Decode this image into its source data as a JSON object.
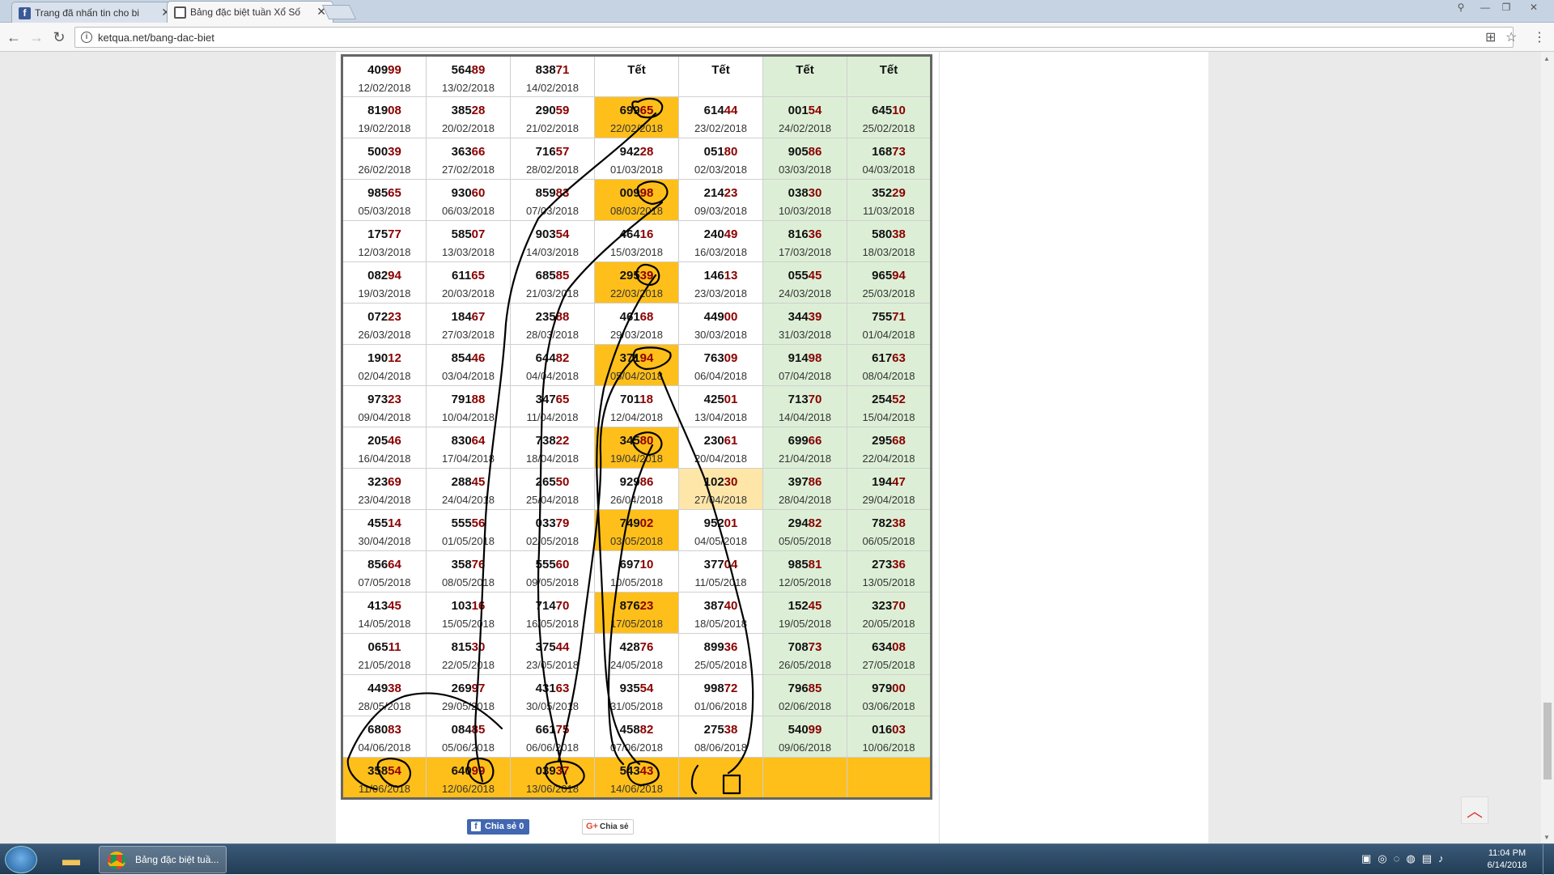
{
  "browser": {
    "tabs": [
      {
        "title": "Trang đã nhấn tin cho bi",
        "icon": "facebook-icon"
      },
      {
        "title": "Bảng đặc biệt tuần Xổ Số",
        "icon": "ketqua-icon"
      }
    ],
    "url": "ketqua.net/bang-dac-biet"
  },
  "table": {
    "rows": [
      [
        {
          "h": "409",
          "t": "99",
          "d": "12/02/2018",
          "c": "w"
        },
        {
          "h": "564",
          "t": "89",
          "d": "13/02/2018",
          "c": "w"
        },
        {
          "h": "838",
          "t": "71",
          "d": "14/02/2018",
          "c": "w"
        },
        {
          "h": "Tết",
          "t": "",
          "d": "",
          "c": "w"
        },
        {
          "h": "Tết",
          "t": "",
          "d": "",
          "c": "w"
        },
        {
          "h": "Tết",
          "t": "",
          "d": "",
          "c": "g"
        },
        {
          "h": "Tết",
          "t": "",
          "d": "",
          "c": "g"
        }
      ],
      [
        {
          "h": "819",
          "t": "08",
          "d": "19/02/2018",
          "c": "w"
        },
        {
          "h": "385",
          "t": "28",
          "d": "20/02/2018",
          "c": "w"
        },
        {
          "h": "290",
          "t": "59",
          "d": "21/02/2018",
          "c": "w"
        },
        {
          "h": "699",
          "t": "65",
          "d": "22/02/2018",
          "c": "o"
        },
        {
          "h": "614",
          "t": "44",
          "d": "23/02/2018",
          "c": "w"
        },
        {
          "h": "001",
          "t": "54",
          "d": "24/02/2018",
          "c": "g"
        },
        {
          "h": "645",
          "t": "10",
          "d": "25/02/2018",
          "c": "g"
        }
      ],
      [
        {
          "h": "500",
          "t": "39",
          "d": "26/02/2018",
          "c": "w"
        },
        {
          "h": "363",
          "t": "66",
          "d": "27/02/2018",
          "c": "w"
        },
        {
          "h": "716",
          "t": "57",
          "d": "28/02/2018",
          "c": "w"
        },
        {
          "h": "942",
          "t": "28",
          "d": "01/03/2018",
          "c": "w"
        },
        {
          "h": "051",
          "t": "80",
          "d": "02/03/2018",
          "c": "w"
        },
        {
          "h": "905",
          "t": "86",
          "d": "03/03/2018",
          "c": "g"
        },
        {
          "h": "168",
          "t": "73",
          "d": "04/03/2018",
          "c": "g"
        }
      ],
      [
        {
          "h": "985",
          "t": "65",
          "d": "05/03/2018",
          "c": "w"
        },
        {
          "h": "930",
          "t": "60",
          "d": "06/03/2018",
          "c": "w"
        },
        {
          "h": "859",
          "t": "83",
          "d": "07/03/2018",
          "c": "w"
        },
        {
          "h": "009",
          "t": "98",
          "d": "08/03/2018",
          "c": "o"
        },
        {
          "h": "214",
          "t": "23",
          "d": "09/03/2018",
          "c": "w"
        },
        {
          "h": "038",
          "t": "30",
          "d": "10/03/2018",
          "c": "g"
        },
        {
          "h": "352",
          "t": "29",
          "d": "11/03/2018",
          "c": "g"
        }
      ],
      [
        {
          "h": "175",
          "t": "77",
          "d": "12/03/2018",
          "c": "w"
        },
        {
          "h": "585",
          "t": "07",
          "d": "13/03/2018",
          "c": "w"
        },
        {
          "h": "903",
          "t": "54",
          "d": "14/03/2018",
          "c": "w"
        },
        {
          "h": "464",
          "t": "16",
          "d": "15/03/2018",
          "c": "w"
        },
        {
          "h": "240",
          "t": "49",
          "d": "16/03/2018",
          "c": "w"
        },
        {
          "h": "816",
          "t": "36",
          "d": "17/03/2018",
          "c": "g"
        },
        {
          "h": "580",
          "t": "38",
          "d": "18/03/2018",
          "c": "g"
        }
      ],
      [
        {
          "h": "082",
          "t": "94",
          "d": "19/03/2018",
          "c": "w"
        },
        {
          "h": "611",
          "t": "65",
          "d": "20/03/2018",
          "c": "w"
        },
        {
          "h": "685",
          "t": "85",
          "d": "21/03/2018",
          "c": "w"
        },
        {
          "h": "295",
          "t": "39",
          "d": "22/03/2018",
          "c": "o"
        },
        {
          "h": "146",
          "t": "13",
          "d": "23/03/2018",
          "c": "w"
        },
        {
          "h": "055",
          "t": "45",
          "d": "24/03/2018",
          "c": "g"
        },
        {
          "h": "965",
          "t": "94",
          "d": "25/03/2018",
          "c": "g"
        }
      ],
      [
        {
          "h": "072",
          "t": "23",
          "d": "26/03/2018",
          "c": "w"
        },
        {
          "h": "184",
          "t": "67",
          "d": "27/03/2018",
          "c": "w"
        },
        {
          "h": "235",
          "t": "88",
          "d": "28/03/2018",
          "c": "w"
        },
        {
          "h": "461",
          "t": "68",
          "d": "29/03/2018",
          "c": "w"
        },
        {
          "h": "449",
          "t": "00",
          "d": "30/03/2018",
          "c": "w"
        },
        {
          "h": "344",
          "t": "39",
          "d": "31/03/2018",
          "c": "g"
        },
        {
          "h": "755",
          "t": "71",
          "d": "01/04/2018",
          "c": "g"
        }
      ],
      [
        {
          "h": "190",
          "t": "12",
          "d": "02/04/2018",
          "c": "w"
        },
        {
          "h": "854",
          "t": "46",
          "d": "03/04/2018",
          "c": "w"
        },
        {
          "h": "644",
          "t": "82",
          "d": "04/04/2018",
          "c": "w"
        },
        {
          "h": "371",
          "t": "94",
          "d": "05/04/2018",
          "c": "o"
        },
        {
          "h": "763",
          "t": "09",
          "d": "06/04/2018",
          "c": "w"
        },
        {
          "h": "914",
          "t": "98",
          "d": "07/04/2018",
          "c": "g"
        },
        {
          "h": "617",
          "t": "63",
          "d": "08/04/2018",
          "c": "g"
        }
      ],
      [
        {
          "h": "973",
          "t": "23",
          "d": "09/04/2018",
          "c": "w"
        },
        {
          "h": "791",
          "t": "88",
          "d": "10/04/2018",
          "c": "w"
        },
        {
          "h": "347",
          "t": "65",
          "d": "11/04/2018",
          "c": "w"
        },
        {
          "h": "701",
          "t": "18",
          "d": "12/04/2018",
          "c": "w"
        },
        {
          "h": "425",
          "t": "01",
          "d": "13/04/2018",
          "c": "w"
        },
        {
          "h": "713",
          "t": "70",
          "d": "14/04/2018",
          "c": "g"
        },
        {
          "h": "254",
          "t": "52",
          "d": "15/04/2018",
          "c": "g"
        }
      ],
      [
        {
          "h": "205",
          "t": "46",
          "d": "16/04/2018",
          "c": "w"
        },
        {
          "h": "830",
          "t": "64",
          "d": "17/04/2018",
          "c": "w"
        },
        {
          "h": "738",
          "t": "22",
          "d": "18/04/2018",
          "c": "w"
        },
        {
          "h": "345",
          "t": "80",
          "d": "19/04/2018",
          "c": "o"
        },
        {
          "h": "230",
          "t": "61",
          "d": "20/04/2018",
          "c": "w"
        },
        {
          "h": "699",
          "t": "66",
          "d": "21/04/2018",
          "c": "g"
        },
        {
          "h": "295",
          "t": "68",
          "d": "22/04/2018",
          "c": "g"
        }
      ],
      [
        {
          "h": "323",
          "t": "69",
          "d": "23/04/2018",
          "c": "w"
        },
        {
          "h": "288",
          "t": "45",
          "d": "24/04/2018",
          "c": "w"
        },
        {
          "h": "265",
          "t": "50",
          "d": "25/04/2018",
          "c": "w"
        },
        {
          "h": "929",
          "t": "86",
          "d": "26/04/2018",
          "c": "w"
        },
        {
          "h": "102",
          "t": "30",
          "d": "27/04/2018",
          "c": "y"
        },
        {
          "h": "397",
          "t": "86",
          "d": "28/04/2018",
          "c": "g"
        },
        {
          "h": "194",
          "t": "47",
          "d": "29/04/2018",
          "c": "g"
        }
      ],
      [
        {
          "h": "455",
          "t": "14",
          "d": "30/04/2018",
          "c": "w"
        },
        {
          "h": "555",
          "t": "56",
          "d": "01/05/2018",
          "c": "w"
        },
        {
          "h": "033",
          "t": "79",
          "d": "02/05/2018",
          "c": "w"
        },
        {
          "h": "749",
          "t": "02",
          "d": "03/05/2018",
          "c": "o"
        },
        {
          "h": "952",
          "t": "01",
          "d": "04/05/2018",
          "c": "w"
        },
        {
          "h": "294",
          "t": "82",
          "d": "05/05/2018",
          "c": "g"
        },
        {
          "h": "782",
          "t": "38",
          "d": "06/05/2018",
          "c": "g"
        }
      ],
      [
        {
          "h": "856",
          "t": "64",
          "d": "07/05/2018",
          "c": "w"
        },
        {
          "h": "358",
          "t": "76",
          "d": "08/05/2018",
          "c": "w"
        },
        {
          "h": "555",
          "t": "60",
          "d": "09/05/2018",
          "c": "w"
        },
        {
          "h": "697",
          "t": "10",
          "d": "10/05/2018",
          "c": "w"
        },
        {
          "h": "377",
          "t": "04",
          "d": "11/05/2018",
          "c": "w"
        },
        {
          "h": "985",
          "t": "81",
          "d": "12/05/2018",
          "c": "g"
        },
        {
          "h": "273",
          "t": "36",
          "d": "13/05/2018",
          "c": "g"
        }
      ],
      [
        {
          "h": "413",
          "t": "45",
          "d": "14/05/2018",
          "c": "w"
        },
        {
          "h": "103",
          "t": "16",
          "d": "15/05/2018",
          "c": "w"
        },
        {
          "h": "714",
          "t": "70",
          "d": "16/05/2018",
          "c": "w"
        },
        {
          "h": "876",
          "t": "23",
          "d": "17/05/2018",
          "c": "o"
        },
        {
          "h": "387",
          "t": "40",
          "d": "18/05/2018",
          "c": "w"
        },
        {
          "h": "152",
          "t": "45",
          "d": "19/05/2018",
          "c": "g"
        },
        {
          "h": "323",
          "t": "70",
          "d": "20/05/2018",
          "c": "g"
        }
      ],
      [
        {
          "h": "065",
          "t": "11",
          "d": "21/05/2018",
          "c": "w"
        },
        {
          "h": "815",
          "t": "30",
          "d": "22/05/2018",
          "c": "w"
        },
        {
          "h": "375",
          "t": "44",
          "d": "23/05/2018",
          "c": "w"
        },
        {
          "h": "428",
          "t": "76",
          "d": "24/05/2018",
          "c": "w"
        },
        {
          "h": "899",
          "t": "36",
          "d": "25/05/2018",
          "c": "w"
        },
        {
          "h": "708",
          "t": "73",
          "d": "26/05/2018",
          "c": "g"
        },
        {
          "h": "634",
          "t": "08",
          "d": "27/05/2018",
          "c": "g"
        }
      ],
      [
        {
          "h": "449",
          "t": "38",
          "d": "28/05/2018",
          "c": "w"
        },
        {
          "h": "269",
          "t": "97",
          "d": "29/05/2018",
          "c": "w"
        },
        {
          "h": "431",
          "t": "63",
          "d": "30/05/2018",
          "c": "w"
        },
        {
          "h": "935",
          "t": "54",
          "d": "31/05/2018",
          "c": "w"
        },
        {
          "h": "998",
          "t": "72",
          "d": "01/06/2018",
          "c": "w"
        },
        {
          "h": "796",
          "t": "85",
          "d": "02/06/2018",
          "c": "g"
        },
        {
          "h": "979",
          "t": "00",
          "d": "03/06/2018",
          "c": "g"
        }
      ],
      [
        {
          "h": "680",
          "t": "83",
          "d": "04/06/2018",
          "c": "w"
        },
        {
          "h": "084",
          "t": "85",
          "d": "05/06/2018",
          "c": "w"
        },
        {
          "h": "661",
          "t": "75",
          "d": "06/06/2018",
          "c": "w"
        },
        {
          "h": "458",
          "t": "82",
          "d": "07/06/2018",
          "c": "w"
        },
        {
          "h": "275",
          "t": "38",
          "d": "08/06/2018",
          "c": "w"
        },
        {
          "h": "540",
          "t": "99",
          "d": "09/06/2018",
          "c": "g"
        },
        {
          "h": "016",
          "t": "03",
          "d": "10/06/2018",
          "c": "g"
        }
      ],
      [
        {
          "h": "358",
          "t": "54",
          "d": "11/06/2018",
          "c": "o"
        },
        {
          "h": "640",
          "t": "99",
          "d": "12/06/2018",
          "c": "o"
        },
        {
          "h": "039",
          "t": "37",
          "d": "13/06/2018",
          "c": "o"
        },
        {
          "h": "543",
          "t": "43",
          "d": "14/06/2018",
          "c": "o"
        },
        {
          "h": "",
          "t": "",
          "d": "",
          "c": "o"
        },
        {
          "h": "",
          "t": "",
          "d": "",
          "c": "o"
        },
        {
          "h": "",
          "t": "",
          "d": "",
          "c": "o"
        }
      ]
    ]
  },
  "share": {
    "facebook_label": "Chia sẻ",
    "facebook_count": "0",
    "google_label": "Chia sẻ",
    "google_glyph": "G+"
  },
  "taskbar": {
    "chrome_label": "Bảng đặc biệt tuầ...",
    "time": "11:04 PM",
    "date": "6/14/2018"
  },
  "colors": {
    "orange_highlight": "#ffbf1a",
    "weekend_green": "#dcefd6",
    "tail_digits": "#8b0000"
  }
}
